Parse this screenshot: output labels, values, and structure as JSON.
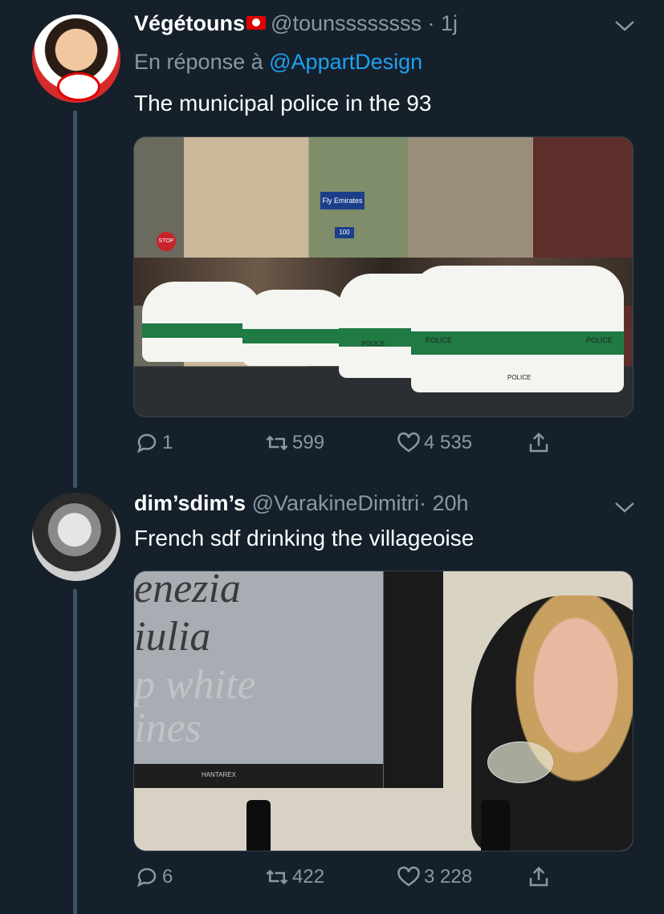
{
  "tweets": [
    {
      "name": "Végétouns",
      "handle": "@tounssssssss",
      "time": "· 1j",
      "reply_prefix": "En réponse à",
      "reply_mention": "@AppartDesign",
      "text": "The municipal police in the 93",
      "media_text": [
        "Fly Emirates",
        "100",
        "STOP",
        "POLICE",
        "POLICE",
        "POLICE",
        "POLICE"
      ],
      "replies": "1",
      "retweets": "599",
      "likes": "4 535"
    },
    {
      "name": "dim’sdim’s",
      "handle": "@VarakineDimitri",
      "time": "· 20h",
      "text": "French sdf drinking the villageoise",
      "media_text": [
        "enezia",
        "iulia",
        "p white",
        "ines",
        "HANTAREX"
      ],
      "replies": "6",
      "retweets": "422",
      "likes": "3 228"
    }
  ],
  "icons": {
    "reply": "reply-icon",
    "retweet": "retweet-icon",
    "like": "heart-icon",
    "share": "share-icon",
    "menu": "chevron-down-icon"
  },
  "colors": {
    "background": "#15202b",
    "secondary_text": "#8899a6",
    "link": "#1da1f2",
    "thread_line": "#3d5466"
  }
}
